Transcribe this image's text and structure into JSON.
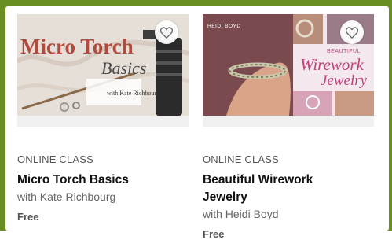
{
  "cards": [
    {
      "thumb_title_line1": "Micro Torch",
      "thumb_title_line2": "Basics",
      "thumb_author": "with Kate Richbourg",
      "kicker": "ONLINE CLASS",
      "title": "Micro Torch Basics",
      "byline": "with Kate Richbourg",
      "price": "Free"
    },
    {
      "thumb_author": "HEIDI BOYD",
      "thumb_title_line1": "BEAUTIFUL",
      "thumb_title_line2": "Wirework",
      "thumb_title_line3": "Jewelry",
      "kicker": "ONLINE CLASS",
      "title_line1": "Beautiful Wirework",
      "title_line2": "Jewelry",
      "byline": "with Heidi Boyd",
      "price": "Free"
    }
  ],
  "colors": {
    "frame": "#6b8e23",
    "pink": "#c2417b"
  },
  "icons": [
    "heart-icon"
  ]
}
